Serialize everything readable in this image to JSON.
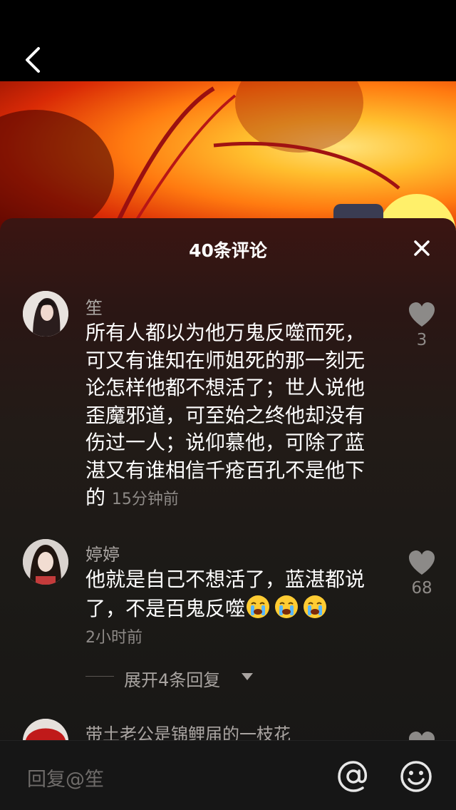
{
  "nav": {
    "back_icon": "chevron-left-icon"
  },
  "panel": {
    "title": "40条评论",
    "close_icon": "close-icon"
  },
  "comments": [
    {
      "username": "笙",
      "text": "所有人都以为他万鬼反噬而死，可又有谁知在师姐死的那一刻无论怎样他都不想活了；世人说他歪魔邪道，可至始之终他却没有伤过一人；说仰慕他，可除了蓝湛又有谁相信千疮百孔不是他下的",
      "time": "15分钟前",
      "likes": "3",
      "avatar_icon": "avatar-dark-hair"
    },
    {
      "username": "婷婷",
      "text": "他就是自己不想活了，蓝湛都说了，不是百鬼反噬",
      "emojis": [
        "crying-face-emoji",
        "crying-face-emoji",
        "crying-face-emoji"
      ],
      "time": "2小时前",
      "likes": "68",
      "avatar_icon": "avatar-woman-photo",
      "expand_label": "展开4条回复"
    },
    {
      "username": "带土老公是锦鲤届的一枝花",
      "avatar_icon": "avatar-red-umbrella"
    }
  ],
  "reply_bar": {
    "placeholder": "回复@笙",
    "at_icon": "at-sign-icon",
    "emoji_icon": "smiley-icon"
  },
  "colors": {
    "accent_like": "#8c8a88",
    "panel_bg": "#1c1a17",
    "muted_text": "#a9a4a1"
  }
}
